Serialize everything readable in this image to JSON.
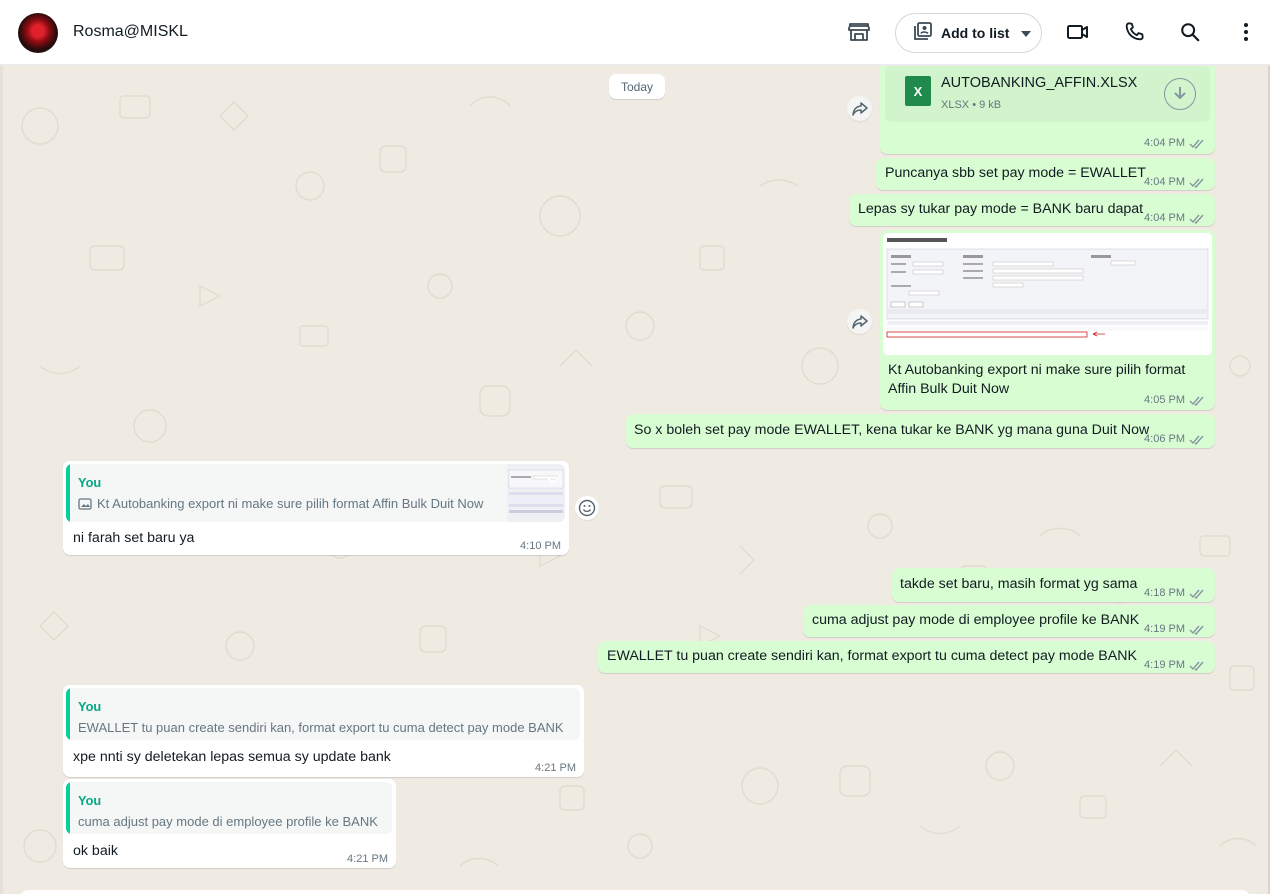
{
  "header": {
    "contact_name": "Rosma@MISKL",
    "add_to_list_label": "Add to list",
    "icons": [
      "catalog-icon",
      "video-call-icon",
      "voice-call-icon",
      "search-icon",
      "menu-icon"
    ]
  },
  "chat": {
    "day_label": "Today",
    "messages": [
      {
        "type": "document",
        "direction": "outgoing",
        "file_name": "AUTOBANKING_AFFIN.XLSX",
        "file_type": "XLSX",
        "file_size": "9 kB",
        "time": "4:04 PM"
      },
      {
        "type": "text",
        "direction": "outgoing",
        "text": "Puncanya sbb set pay mode = EWALLET",
        "time": "4:04 PM"
      },
      {
        "type": "text",
        "direction": "outgoing",
        "text": "Lepas sy tukar pay mode = BANK baru dapat",
        "time": "4:04 PM"
      },
      {
        "type": "image",
        "direction": "outgoing",
        "caption_line1": "Kt Autobanking export ni make sure pilih format",
        "caption_line2": "Affin Bulk Duit Now",
        "time": "4:05 PM"
      },
      {
        "type": "text",
        "direction": "outgoing",
        "text": "So x boleh set pay mode EWALLET, kena tukar ke BANK yg mana guna Duit Now",
        "time": "4:06 PM"
      },
      {
        "type": "reply",
        "direction": "incoming",
        "quote_author": "You",
        "quote_text": "Kt Autobanking export ni make sure pilih format Affin Bulk Duit Now",
        "text": "ni farah set baru ya",
        "time": "4:10 PM"
      },
      {
        "type": "text",
        "direction": "outgoing",
        "text": "takde set baru, masih format yg sama",
        "time": "4:18 PM"
      },
      {
        "type": "text",
        "direction": "outgoing",
        "text": "cuma adjust pay mode di employee profile ke BANK",
        "time": "4:19 PM"
      },
      {
        "type": "text",
        "direction": "outgoing",
        "text": "EWALLET tu puan create sendiri kan, format export tu cuma detect pay mode  BANK",
        "time": "4:19 PM"
      },
      {
        "type": "reply",
        "direction": "incoming",
        "quote_author": "You",
        "quote_text": "EWALLET tu puan create sendiri kan, format export tu cuma detect pay mode  BANK",
        "text": "xpe nnti sy deletekan lepas semua sy update bank",
        "time": "4:21 PM"
      },
      {
        "type": "reply",
        "direction": "incoming",
        "quote_author": "You",
        "quote_text": "cuma adjust pay mode di employee profile ke BANK",
        "text": "ok baik",
        "time": "4:21 PM"
      }
    ]
  },
  "colors": {
    "outgoing_bubble": "#d9fdd3",
    "incoming_bubble": "#ffffff",
    "chat_background": "#efeae2",
    "accent": "#06cf9c",
    "read_ticks": "#8696a0"
  }
}
